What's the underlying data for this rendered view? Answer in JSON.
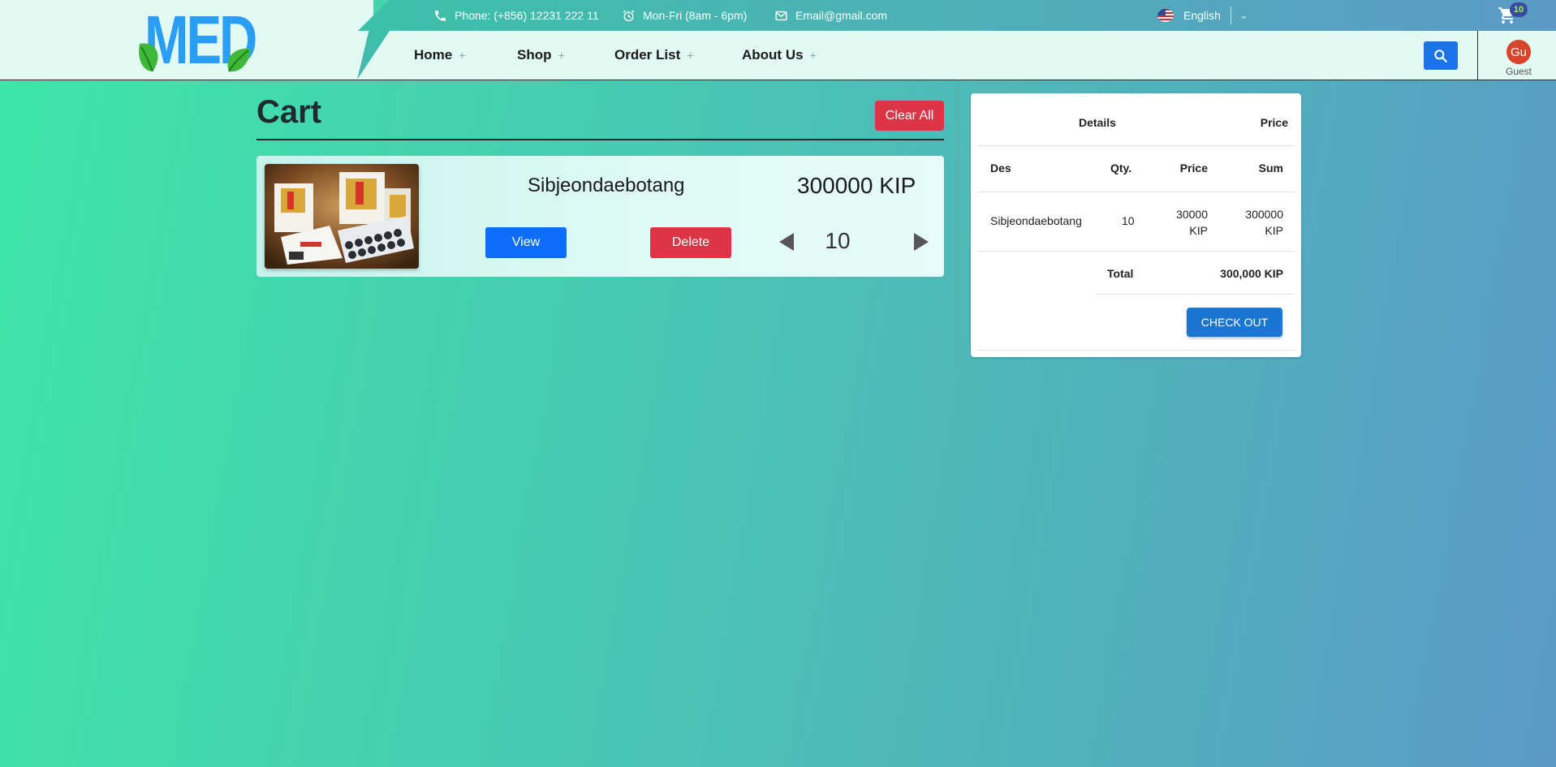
{
  "brand": {
    "logo_text": "MED"
  },
  "topbar": {
    "phone": "Phone: (+856) 12231 222 11",
    "hours": "Mon-Fri (8am - 6pm)",
    "email": "Email@gmail.com",
    "language": "English",
    "cart_count": "10"
  },
  "nav": {
    "items": [
      {
        "label": "Home",
        "icon": "plus-icon"
      },
      {
        "label": "Shop",
        "icon": "plus-icon"
      },
      {
        "label": "Order List",
        "icon": "plus-icon"
      },
      {
        "label": "About Us",
        "icon": "plus-icon"
      }
    ],
    "plus_glyph": "+",
    "avatar_initials": "Gu",
    "user_label": "Guest"
  },
  "cart": {
    "title": "Cart",
    "clear_label": "Clear All",
    "items": [
      {
        "name": "Sibjeondaebotang",
        "price": "300000 KIP",
        "view_label": "View",
        "delete_label": "Delete",
        "quantity": "10"
      }
    ]
  },
  "summary": {
    "header": {
      "details": "Details",
      "price": "Price"
    },
    "columns": {
      "des": "Des",
      "qty": "Qty.",
      "price": "Price",
      "sum": "Sum"
    },
    "rows": [
      {
        "des": "Sibjeondaebotang",
        "qty": "10",
        "price_amount": "30000",
        "price_unit": "KIP",
        "sum_amount": "300000",
        "sum_unit": "KIP"
      }
    ],
    "total_label": "Total",
    "total_value": "300,000 KIP",
    "checkout_label": "CHECK OUT"
  },
  "colors": {
    "brand_blue": "#2a9df4",
    "leaf_green": "#3fb83a",
    "danger": "#dc3545",
    "primary": "#0d6efd",
    "checkout": "#1976d2"
  }
}
